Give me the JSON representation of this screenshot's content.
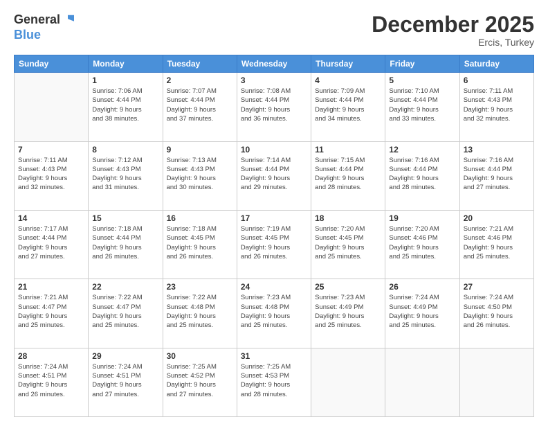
{
  "header": {
    "logo_line1": "General",
    "logo_line2": "Blue",
    "month": "December 2025",
    "location": "Ercis, Turkey"
  },
  "weekdays": [
    "Sunday",
    "Monday",
    "Tuesday",
    "Wednesday",
    "Thursday",
    "Friday",
    "Saturday"
  ],
  "weeks": [
    [
      {
        "day": "",
        "info": ""
      },
      {
        "day": "1",
        "info": "Sunrise: 7:06 AM\nSunset: 4:44 PM\nDaylight: 9 hours\nand 38 minutes."
      },
      {
        "day": "2",
        "info": "Sunrise: 7:07 AM\nSunset: 4:44 PM\nDaylight: 9 hours\nand 37 minutes."
      },
      {
        "day": "3",
        "info": "Sunrise: 7:08 AM\nSunset: 4:44 PM\nDaylight: 9 hours\nand 36 minutes."
      },
      {
        "day": "4",
        "info": "Sunrise: 7:09 AM\nSunset: 4:44 PM\nDaylight: 9 hours\nand 34 minutes."
      },
      {
        "day": "5",
        "info": "Sunrise: 7:10 AM\nSunset: 4:44 PM\nDaylight: 9 hours\nand 33 minutes."
      },
      {
        "day": "6",
        "info": "Sunrise: 7:11 AM\nSunset: 4:43 PM\nDaylight: 9 hours\nand 32 minutes."
      }
    ],
    [
      {
        "day": "7",
        "info": "Sunrise: 7:11 AM\nSunset: 4:43 PM\nDaylight: 9 hours\nand 32 minutes."
      },
      {
        "day": "8",
        "info": "Sunrise: 7:12 AM\nSunset: 4:43 PM\nDaylight: 9 hours\nand 31 minutes."
      },
      {
        "day": "9",
        "info": "Sunrise: 7:13 AM\nSunset: 4:43 PM\nDaylight: 9 hours\nand 30 minutes."
      },
      {
        "day": "10",
        "info": "Sunrise: 7:14 AM\nSunset: 4:44 PM\nDaylight: 9 hours\nand 29 minutes."
      },
      {
        "day": "11",
        "info": "Sunrise: 7:15 AM\nSunset: 4:44 PM\nDaylight: 9 hours\nand 28 minutes."
      },
      {
        "day": "12",
        "info": "Sunrise: 7:16 AM\nSunset: 4:44 PM\nDaylight: 9 hours\nand 28 minutes."
      },
      {
        "day": "13",
        "info": "Sunrise: 7:16 AM\nSunset: 4:44 PM\nDaylight: 9 hours\nand 27 minutes."
      }
    ],
    [
      {
        "day": "14",
        "info": "Sunrise: 7:17 AM\nSunset: 4:44 PM\nDaylight: 9 hours\nand 27 minutes."
      },
      {
        "day": "15",
        "info": "Sunrise: 7:18 AM\nSunset: 4:44 PM\nDaylight: 9 hours\nand 26 minutes."
      },
      {
        "day": "16",
        "info": "Sunrise: 7:18 AM\nSunset: 4:45 PM\nDaylight: 9 hours\nand 26 minutes."
      },
      {
        "day": "17",
        "info": "Sunrise: 7:19 AM\nSunset: 4:45 PM\nDaylight: 9 hours\nand 26 minutes."
      },
      {
        "day": "18",
        "info": "Sunrise: 7:20 AM\nSunset: 4:45 PM\nDaylight: 9 hours\nand 25 minutes."
      },
      {
        "day": "19",
        "info": "Sunrise: 7:20 AM\nSunset: 4:46 PM\nDaylight: 9 hours\nand 25 minutes."
      },
      {
        "day": "20",
        "info": "Sunrise: 7:21 AM\nSunset: 4:46 PM\nDaylight: 9 hours\nand 25 minutes."
      }
    ],
    [
      {
        "day": "21",
        "info": "Sunrise: 7:21 AM\nSunset: 4:47 PM\nDaylight: 9 hours\nand 25 minutes."
      },
      {
        "day": "22",
        "info": "Sunrise: 7:22 AM\nSunset: 4:47 PM\nDaylight: 9 hours\nand 25 minutes."
      },
      {
        "day": "23",
        "info": "Sunrise: 7:22 AM\nSunset: 4:48 PM\nDaylight: 9 hours\nand 25 minutes."
      },
      {
        "day": "24",
        "info": "Sunrise: 7:23 AM\nSunset: 4:48 PM\nDaylight: 9 hours\nand 25 minutes."
      },
      {
        "day": "25",
        "info": "Sunrise: 7:23 AM\nSunset: 4:49 PM\nDaylight: 9 hours\nand 25 minutes."
      },
      {
        "day": "26",
        "info": "Sunrise: 7:24 AM\nSunset: 4:49 PM\nDaylight: 9 hours\nand 25 minutes."
      },
      {
        "day": "27",
        "info": "Sunrise: 7:24 AM\nSunset: 4:50 PM\nDaylight: 9 hours\nand 26 minutes."
      }
    ],
    [
      {
        "day": "28",
        "info": "Sunrise: 7:24 AM\nSunset: 4:51 PM\nDaylight: 9 hours\nand 26 minutes."
      },
      {
        "day": "29",
        "info": "Sunrise: 7:24 AM\nSunset: 4:51 PM\nDaylight: 9 hours\nand 27 minutes."
      },
      {
        "day": "30",
        "info": "Sunrise: 7:25 AM\nSunset: 4:52 PM\nDaylight: 9 hours\nand 27 minutes."
      },
      {
        "day": "31",
        "info": "Sunrise: 7:25 AM\nSunset: 4:53 PM\nDaylight: 9 hours\nand 28 minutes."
      },
      {
        "day": "",
        "info": ""
      },
      {
        "day": "",
        "info": ""
      },
      {
        "day": "",
        "info": ""
      }
    ]
  ]
}
